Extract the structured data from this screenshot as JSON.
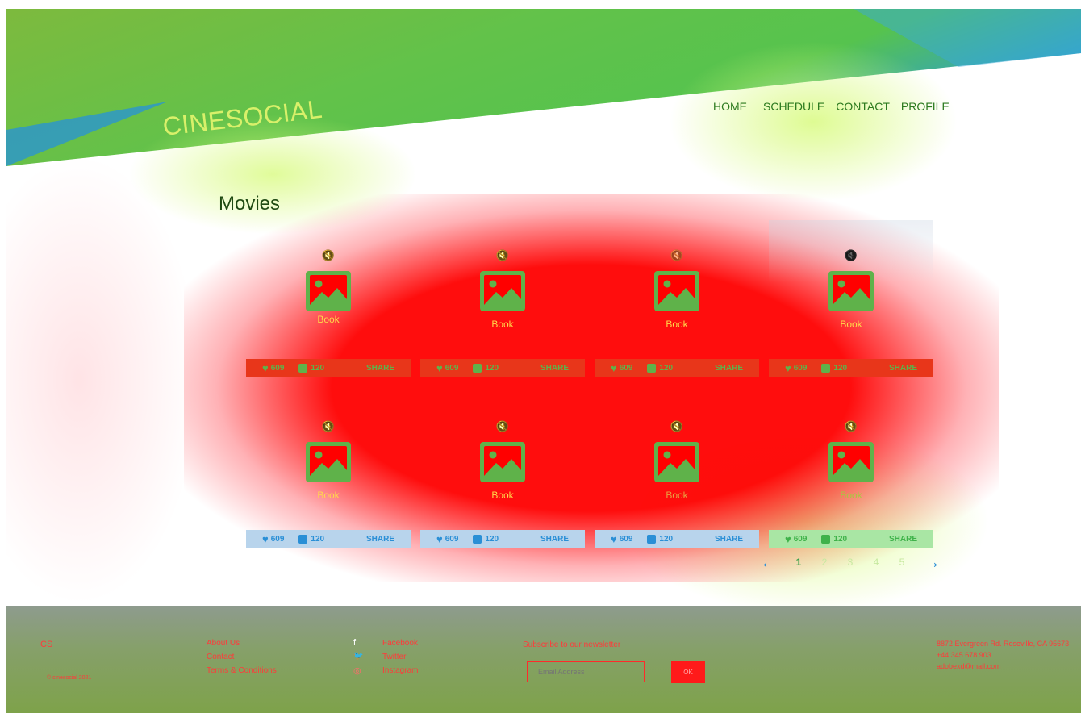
{
  "brand": {
    "logo": "CINESOCIAL"
  },
  "nav": {
    "items": [
      "HOME",
      "SCHEDULE",
      "CONTACT",
      "PROFILE"
    ]
  },
  "main": {
    "title": "Movies",
    "cards": [
      {
        "book_label": "Book",
        "likes": "609",
        "comments": "120",
        "share_label": "SHARE"
      },
      {
        "book_label": "Book",
        "likes": "609",
        "comments": "120",
        "share_label": "SHARE"
      },
      {
        "book_label": "Book",
        "likes": "609",
        "comments": "120",
        "share_label": "SHARE"
      },
      {
        "book_label": "Book",
        "likes": "609",
        "comments": "120",
        "share_label": "SHARE"
      },
      {
        "book_label": "Book",
        "likes": "609",
        "comments": "120",
        "share_label": "SHARE"
      },
      {
        "book_label": "Book",
        "likes": "609",
        "comments": "120",
        "share_label": "SHARE"
      },
      {
        "book_label": "Book",
        "likes": "609",
        "comments": "120",
        "share_label": "SHARE"
      },
      {
        "book_label": "Book",
        "likes": "609",
        "comments": "120",
        "share_label": "SHARE"
      }
    ],
    "icons": {
      "mute": "mute-icon",
      "image": "image-placeholder-icon",
      "heart": "heart-icon",
      "comment": "comment-icon"
    }
  },
  "pagination": {
    "pages": [
      "1",
      "2",
      "3",
      "4",
      "5"
    ],
    "current": "1",
    "prev": "←",
    "next": "→"
  },
  "footer": {
    "logo": "CS",
    "copyright": "© cinesocial 2021",
    "links": [
      "About Us",
      "Contact",
      "Terms & Conditions"
    ],
    "social": [
      {
        "icon": "facebook-icon",
        "glyph": "f",
        "label": "Facebook"
      },
      {
        "icon": "twitter-icon",
        "glyph": "🐦",
        "label": "Twitter"
      },
      {
        "icon": "instagram-icon",
        "glyph": "◎",
        "label": "Instagram"
      }
    ],
    "newsletter": {
      "heading": "Subscribe to our newsletter",
      "placeholder": "Email Address",
      "button": "OK"
    },
    "contact": {
      "address": "8872 Evergreen Rd. Roseville, CA 95673",
      "phone": "+44 345 678 903",
      "email": "adobexd@mail.com"
    }
  },
  "colors": {
    "card_red": "#ff0000",
    "accent_green": "#5fb24a",
    "nav_green": "#2b7a1e",
    "bar_blue": "#2a8fd6",
    "gold": "#e6c24a"
  }
}
